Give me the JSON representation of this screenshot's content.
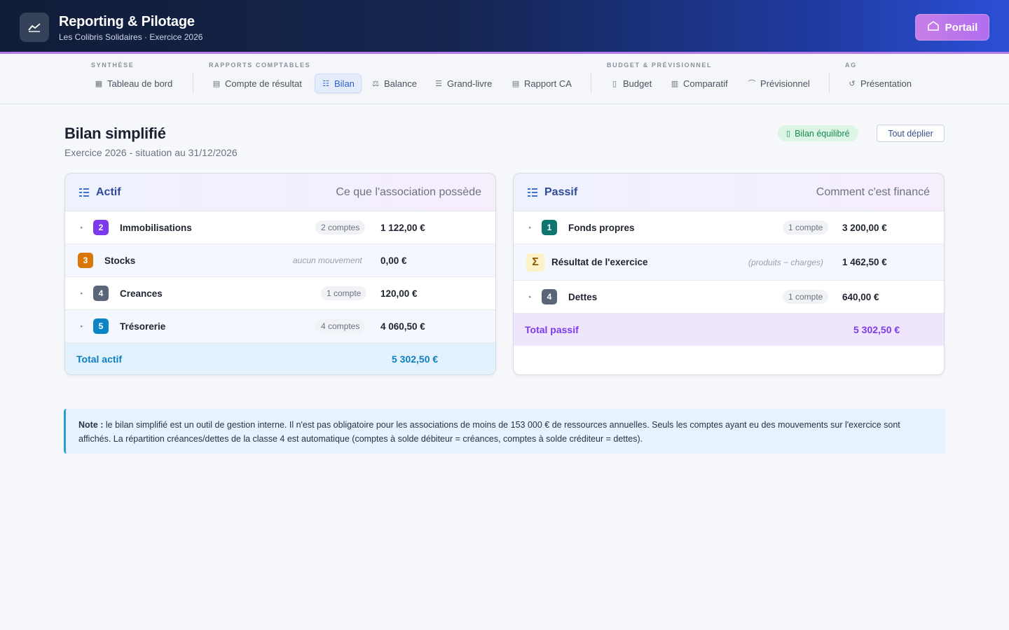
{
  "header": {
    "title": "Reporting & Pilotage",
    "subtitle": "Les Colibris Solidaires · Exercice 2026",
    "portal_label": "Portail",
    "logo_icon": "chart-line-icon",
    "portal_icon": "home-icon"
  },
  "nav": {
    "groups": [
      {
        "label": "SYNTHÈSE"
      },
      {
        "label": "RAPPORTS COMPTABLES"
      },
      {
        "label": "BUDGET & PRÉVISIONNEL"
      },
      {
        "label": "AG"
      }
    ],
    "items": [
      {
        "label": "Tableau de bord",
        "icon": "grid-icon"
      },
      {
        "label": "Compte de résultat",
        "icon": "document-icon"
      },
      {
        "label": "Bilan",
        "icon": "list-icon",
        "active": true
      },
      {
        "label": "Balance",
        "icon": "scale-icon"
      },
      {
        "label": "Grand-livre",
        "icon": "lines-icon"
      },
      {
        "label": "Rapport CA",
        "icon": "document-icon"
      },
      {
        "label": "Budget",
        "icon": "receipt-icon"
      },
      {
        "label": "Comparatif",
        "icon": "bar-chart-icon"
      },
      {
        "label": "Prévisionnel",
        "icon": "trend-icon"
      },
      {
        "label": "Présentation",
        "icon": "history-icon"
      }
    ]
  },
  "page": {
    "title": "Bilan simplifié",
    "subtitle": "Exercice 2026 - situation au 31/12/2026",
    "status_badge": "Bilan équilibré",
    "expand_label": "Tout déplier"
  },
  "actif": {
    "title": "Actif",
    "desc": "Ce que l'association possède",
    "rows": [
      {
        "num": "2",
        "label": "Immobilisations",
        "count": "2 comptes",
        "amount": "1 122,00 €",
        "color": "#7c3aed"
      },
      {
        "num": "3",
        "label": "Stocks",
        "count": "aucun mouvement",
        "amount": "0,00 €",
        "color": "#d97706"
      },
      {
        "num": "4",
        "label": "Creances",
        "count": "1 compte",
        "amount": "120,00 €",
        "color": "#5b6478"
      },
      {
        "num": "5",
        "label": "Trésorerie",
        "count": "4 comptes",
        "amount": "4 060,50 €",
        "color": "#0c84c6"
      }
    ],
    "total_label": "Total actif",
    "total_amount": "5 302,50 €"
  },
  "passif": {
    "title": "Passif",
    "desc": "Comment c'est financé",
    "rows": [
      {
        "num": "1",
        "label": "Fonds propres",
        "count": "1 compte",
        "amount": "3 200,00 €",
        "color": "#0f766e"
      },
      {
        "num": "Σ",
        "label": "Résultat de l'exercice",
        "count": "(produits − charges)",
        "amount": "1 462,50 €",
        "color": "#fdf1c7"
      },
      {
        "num": "4",
        "label": "Dettes",
        "count": "1 compte",
        "amount": "640,00 €",
        "color": "#5b6478"
      }
    ],
    "total_label": "Total passif",
    "total_amount": "5 302,50 €"
  },
  "note": {
    "lead": "Note :",
    "text": " le bilan simplifié est un outil de gestion interne. Il n'est pas obligatoire pour les associations de moins de 153 000 € de ressources annuelles. Seuls les comptes ayant eu des mouvements sur l'exercice sont affichés. La répartition créances/dettes de la classe 4 est automatique (comptes à solde débiteur = créances, comptes à solde créditeur = dettes)."
  },
  "colors": {
    "accent": "#2f5fcf",
    "actif_total": "#0c84c6",
    "passif_total": "#7c3aed",
    "success": "#178a4a"
  }
}
